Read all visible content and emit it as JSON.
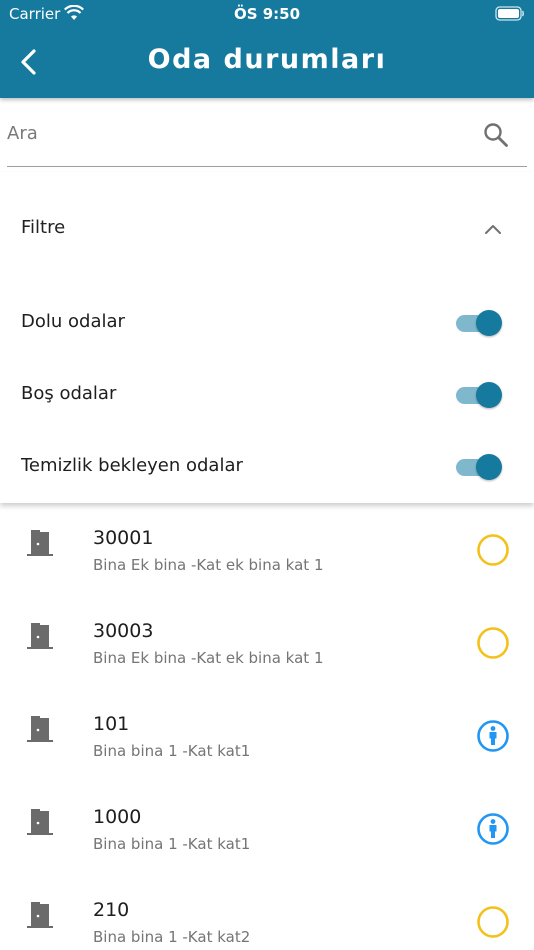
{
  "status_bar": {
    "carrier": "Carrier",
    "time": "ÖS 9:50"
  },
  "header": {
    "title": "Oda durumları",
    "back_icon": "chevron-left-icon"
  },
  "search": {
    "placeholder": "Ara",
    "value": "",
    "icon": "search-icon"
  },
  "filter": {
    "title": "Filtre",
    "expanded": true,
    "toggles": [
      {
        "label": "Dolu odalar",
        "on": true
      },
      {
        "label": "Boş odalar",
        "on": true
      },
      {
        "label": "Temizlik bekleyen odalar",
        "on": true
      }
    ]
  },
  "rooms": [
    {
      "number": "30001",
      "location": "Bina Ek bina -Kat ek bina kat 1",
      "status": "empty-circle-icon"
    },
    {
      "number": "30003",
      "location": "Bina Ek bina -Kat ek bina kat 1",
      "status": "empty-circle-icon"
    },
    {
      "number": "101",
      "location": "Bina bina 1 -Kat kat1",
      "status": "occupied-person-icon"
    },
    {
      "number": "1000",
      "location": "Bina bina 1 -Kat kat1",
      "status": "occupied-person-icon"
    },
    {
      "number": "210",
      "location": "Bina bina 1 -Kat kat2",
      "status": "empty-circle-icon"
    }
  ],
  "colors": {
    "primary": "#167a9e",
    "toggle_track": "#7fb8cc",
    "empty_status": "#f4c01b",
    "occupied_status": "#2196f3",
    "door_icon": "#6b6b6b"
  }
}
